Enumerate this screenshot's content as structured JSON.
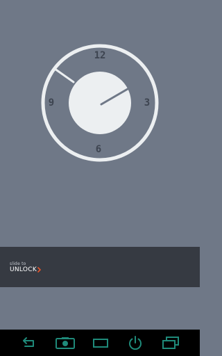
{
  "clock": {
    "numerals": {
      "twelve": "12",
      "three": "3",
      "six": "6",
      "nine": "9"
    },
    "colors": {
      "ring": "#eceff1",
      "face": "#eceff1",
      "numerals": "#3d4450",
      "hand": "#6f7887"
    }
  },
  "unlock": {
    "slide_to": "slide to",
    "unlock": "UNLOCK",
    "arrow_color": "#e8552a"
  },
  "navbar": {
    "icons": [
      "back-icon",
      "camera-icon",
      "recent-apps-icon",
      "power-icon",
      "multi-window-icon"
    ],
    "icon_color": "#1f8a7a"
  },
  "colors": {
    "background": "#6f7887",
    "unlock_bar": "#363a42",
    "navbar": "#000000"
  }
}
